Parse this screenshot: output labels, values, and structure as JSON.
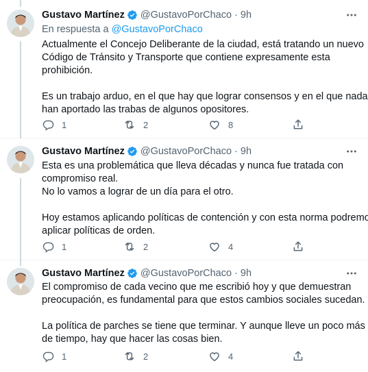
{
  "tweets": [
    {
      "author_name": "Gustavo Martínez",
      "author_handle": "@GustavoPorChaco",
      "separator": "·",
      "time": "9h",
      "reply_prefix": "En respuesta a",
      "reply_mention": "@GustavoPorChaco",
      "lines": [
        "Actualmente el Concejo Deliberante de la ciudad, está tratando un nuevo",
        "Código de Tránsito y Transporte que contiene expresamente esta",
        "prohibición.",
        "",
        "Es un trabajo arduo, en el que hay que lograr consensos y en el que nada",
        "han aportado las trabas de algunos opositores."
      ],
      "replies": "1",
      "retweets": "2",
      "likes": "8"
    },
    {
      "author_name": "Gustavo Martínez",
      "author_handle": "@GustavoPorChaco",
      "separator": "·",
      "time": "9h",
      "lines": [
        "Esta es una problemática que lleva décadas y nunca fue tratada con",
        "compromiso real.",
        "No lo vamos a lograr de un día para el otro.",
        "",
        "Hoy estamos aplicando políticas de contención y con esta norma podremos",
        "aplicar políticas de orden."
      ],
      "replies": "1",
      "retweets": "2",
      "likes": "4"
    },
    {
      "author_name": "Gustavo Martínez",
      "author_handle": "@GustavoPorChaco",
      "separator": "·",
      "time": "9h",
      "lines": [
        "El compromiso de cada vecino que me escribió hoy y que demuestran",
        "preocupación, es fundamental para que estos cambios sociales sucedan.",
        "",
        "La política de parches se tiene que terminar. Y aunque lleve un poco más",
        "de tiempo, hay que hacer las cosas bien."
      ],
      "replies": "1",
      "retweets": "2",
      "likes": "4"
    }
  ],
  "icons": {
    "verified": "verified-badge-icon",
    "more": "more-options-icon",
    "reply": "reply-icon",
    "retweet": "retweet-icon",
    "like": "like-icon",
    "share": "share-icon"
  },
  "colors": {
    "accent": "#1d9bf0",
    "secondary_text": "#536471",
    "thread_line": "#cfd9de",
    "divider": "#eff3f4"
  }
}
